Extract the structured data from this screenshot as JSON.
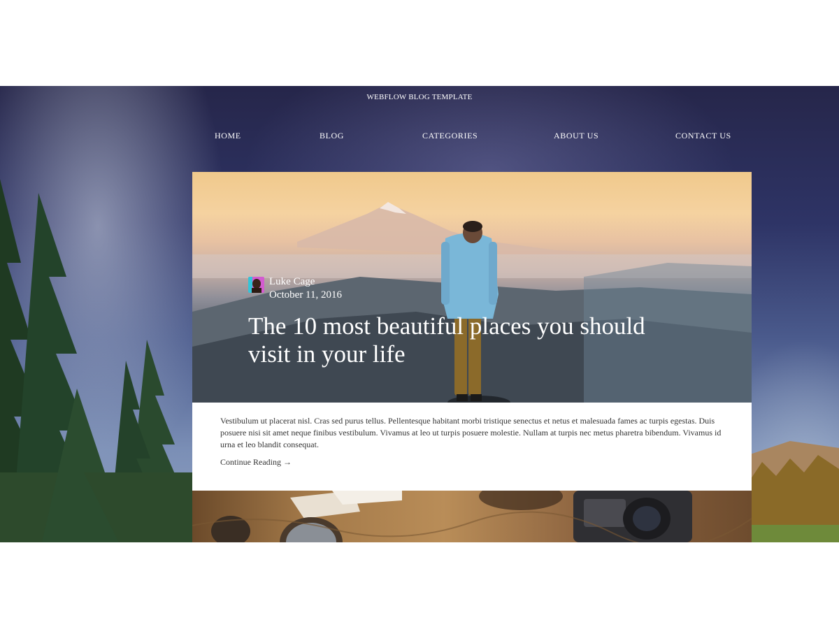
{
  "site": {
    "title": "WEBFLOW BLOG TEMPLATE"
  },
  "nav": {
    "items": [
      {
        "label": "HOME"
      },
      {
        "label": "BLOG"
      },
      {
        "label": "CATEGORIES"
      },
      {
        "label": "ABOUT US"
      },
      {
        "label": "CONTACT US"
      }
    ]
  },
  "featured_post": {
    "author": "Luke Cage",
    "date": "October 11, 2016",
    "title": "The 10 most beautiful places you should visit in your life",
    "excerpt": "Vestibulum ut placerat nisl. Cras sed purus tellus. Pellentesque habitant morbi tristique senectus et netus et malesuada fames ac turpis egestas. Duis posuere nisi sit amet neque finibus vestibulum. Vivamus at leo ut turpis posuere molestie. Nullam at turpis nec metus pharetra bibendum. Vivamus id urna et leo blandit consequat.",
    "read_more": "Continue Reading →"
  },
  "colors": {
    "text_on_image": "#ffffff",
    "body_text": "#333333",
    "card_background": "#ffffff"
  }
}
